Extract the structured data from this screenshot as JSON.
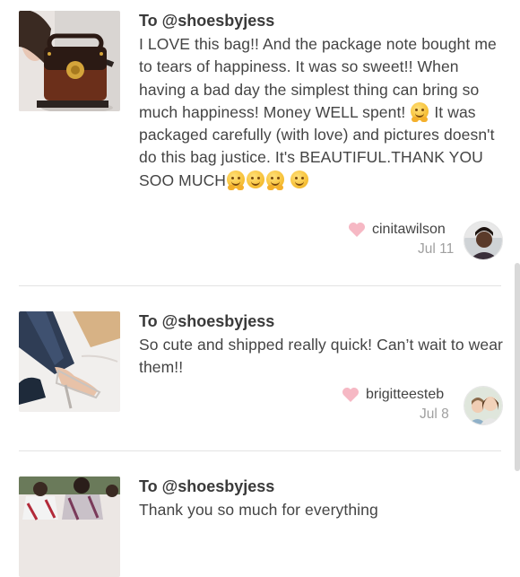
{
  "reviews": [
    {
      "to": "To @shoesbyjess",
      "text_parts": [
        "I LOVE this bag!! And the package note bought me to tears of happiness. It was so sweet!! When having a bad day the simplest thing can bring so much happiness! Money WELL spent! ",
        " It was packaged carefully (with love) and pictures doesn't do this bag justice. It's BEAUTIFUL.THANK YOU SOO MUCH"
      ],
      "username": "cinitawilson",
      "date": "Jul 11",
      "thumbnail": "handbag-photo",
      "avatar": "user-avatar"
    },
    {
      "to": "To @shoesbyjess",
      "text": "So cute and shipped really quick! Can’t wait to wear them!!",
      "username": "brigitteesteb",
      "date": "Jul 8",
      "thumbnail": "heels-photo",
      "avatar": "user-avatar"
    },
    {
      "to": "To @shoesbyjess",
      "text": "Thank you so much for everything",
      "thumbnail": "clothing-photo"
    }
  ],
  "colors": {
    "heart": "#f6b8c4",
    "divider": "#e3e3e3",
    "date": "#a0a0a0"
  }
}
